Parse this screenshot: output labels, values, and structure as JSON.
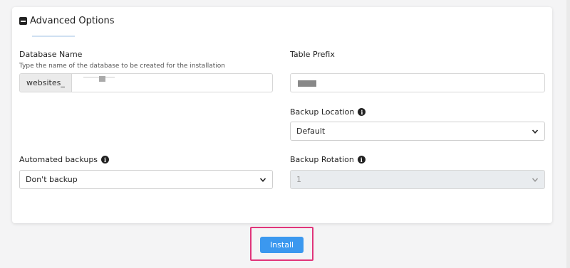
{
  "section": {
    "title": "Advanced Options"
  },
  "database": {
    "label": "Database Name",
    "hint": "Type the name of the database to be created for the installation",
    "prefix": "websites_"
  },
  "table_prefix": {
    "label": "Table Prefix"
  },
  "backup_location": {
    "label": "Backup Location",
    "value": "Default"
  },
  "automated_backups": {
    "label": "Automated backups",
    "value": "Don't backup"
  },
  "backup_rotation": {
    "label": "Backup Rotation",
    "value": "1"
  },
  "install_button": {
    "label": "Install"
  },
  "colors": {
    "accent": "#3b98ef",
    "highlight": "#e0357a"
  },
  "icons": [
    "minus-square-icon",
    "info-icon",
    "chevron-down-icon"
  ]
}
